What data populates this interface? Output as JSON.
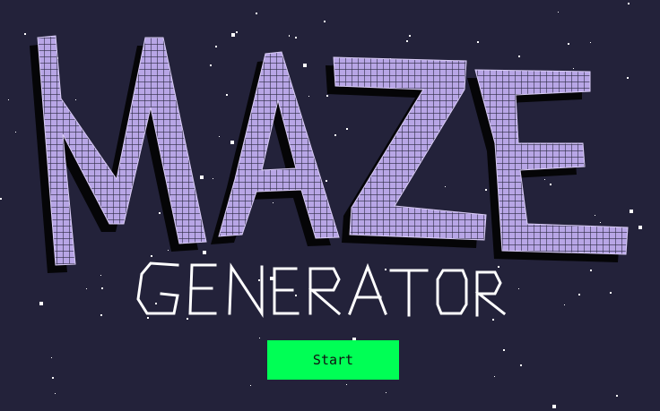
{
  "title": {
    "line1": "MAZE",
    "line2": "GENERATOR"
  },
  "start_button": {
    "label": "Start"
  },
  "colors": {
    "background": "#23223a",
    "maze_fill": "#b8a6e6",
    "maze_grid": "#2c2a44",
    "shadow": "#050507",
    "subtitle_stroke": "#ffffff",
    "button": "#00ff55",
    "button_text": "#111111",
    "stars": "#ffffff"
  }
}
